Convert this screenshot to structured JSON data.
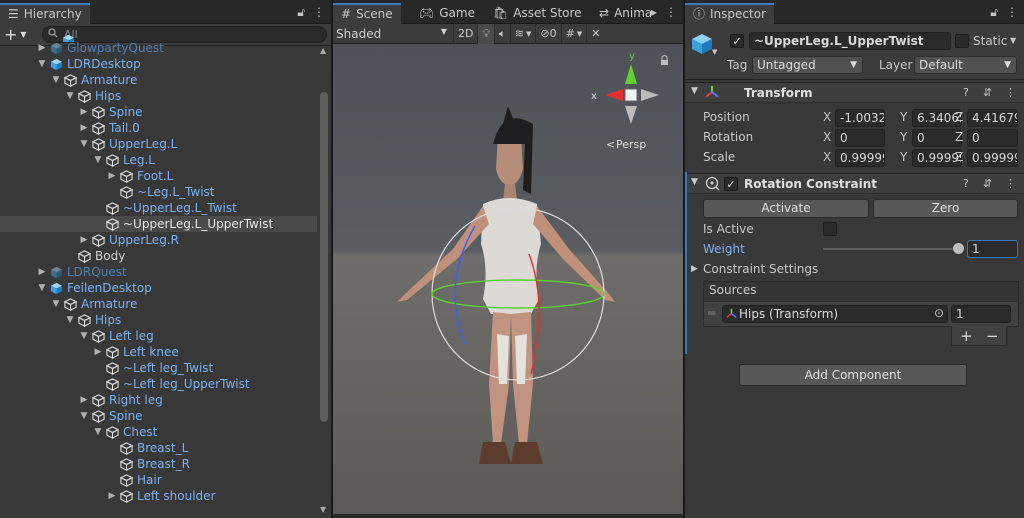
{
  "hierarchy": {
    "tab_label": "Hierarchy",
    "search_placeholder": "All",
    "items": [
      {
        "label": "GlowpartyQuest",
        "depth": 1,
        "arrow": "right",
        "kind": "prefab",
        "dim": true
      },
      {
        "label": "LDRDesktop",
        "depth": 1,
        "arrow": "down",
        "kind": "prefab"
      },
      {
        "label": "Armature",
        "depth": 2,
        "arrow": "down",
        "kind": "cube"
      },
      {
        "label": "Hips",
        "depth": 3,
        "arrow": "down",
        "kind": "cube"
      },
      {
        "label": "Spine",
        "depth": 4,
        "arrow": "right",
        "kind": "cube"
      },
      {
        "label": "Tail.0",
        "depth": 4,
        "arrow": "right",
        "kind": "cube"
      },
      {
        "label": "UpperLeg.L",
        "depth": 4,
        "arrow": "down",
        "kind": "cube"
      },
      {
        "label": "Leg.L",
        "depth": 5,
        "arrow": "down",
        "kind": "cube"
      },
      {
        "label": "Foot.L",
        "depth": 6,
        "arrow": "right",
        "kind": "cube"
      },
      {
        "label": "~Leg.L_Twist",
        "depth": 6,
        "arrow": "",
        "kind": "cube"
      },
      {
        "label": "~UpperLeg.L_Twist",
        "depth": 5,
        "arrow": "",
        "kind": "cube"
      },
      {
        "label": "~UpperLeg.L_UpperTwist",
        "depth": 5,
        "arrow": "",
        "kind": "cube",
        "selected": true
      },
      {
        "label": "UpperLeg.R",
        "depth": 4,
        "arrow": "right",
        "kind": "cube"
      },
      {
        "label": "Body",
        "depth": 3,
        "arrow": "",
        "kind": "cube"
      },
      {
        "label": "LDRQuest",
        "depth": 1,
        "arrow": "right",
        "kind": "prefab",
        "dim": true
      },
      {
        "label": "FeilenDesktop",
        "depth": 1,
        "arrow": "down",
        "kind": "prefab"
      },
      {
        "label": "Armature",
        "depth": 2,
        "arrow": "down",
        "kind": "cube"
      },
      {
        "label": "Hips",
        "depth": 3,
        "arrow": "down",
        "kind": "cube"
      },
      {
        "label": "Left leg",
        "depth": 4,
        "arrow": "down",
        "kind": "cube"
      },
      {
        "label": "Left knee",
        "depth": 5,
        "arrow": "right",
        "kind": "cube"
      },
      {
        "label": "~Left leg_Twist",
        "depth": 5,
        "arrow": "",
        "kind": "cube"
      },
      {
        "label": "~Left leg_UpperTwist",
        "depth": 5,
        "arrow": "",
        "kind": "cube"
      },
      {
        "label": "Right leg",
        "depth": 4,
        "arrow": "right",
        "kind": "cube"
      },
      {
        "label": "Spine",
        "depth": 4,
        "arrow": "down",
        "kind": "cube"
      },
      {
        "label": "Chest",
        "depth": 5,
        "arrow": "down",
        "kind": "cube"
      },
      {
        "label": "Breast_L",
        "depth": 6,
        "arrow": "",
        "kind": "cube"
      },
      {
        "label": "Breast_R",
        "depth": 6,
        "arrow": "",
        "kind": "cube"
      },
      {
        "label": "Hair",
        "depth": 6,
        "arrow": "",
        "kind": "cube"
      },
      {
        "label": "Left shoulder",
        "depth": 6,
        "arrow": "right",
        "kind": "cube"
      }
    ]
  },
  "scene": {
    "tabs": [
      "Scene",
      "Game",
      "Asset Store",
      "Anima"
    ],
    "shading_mode": "Shaded",
    "mode_2d": "2D",
    "hidden_count": "0",
    "persp_label": "Persp",
    "gizmo_x": "x",
    "gizmo_y": "y"
  },
  "inspector": {
    "tab_label": "Inspector",
    "object_name": "~UpperLeg.L_UpperTwist",
    "static_label": "Static",
    "tag_label": "Tag",
    "tag_value": "Untagged",
    "layer_label": "Layer",
    "layer_value": "Default",
    "transform": {
      "title": "Transform",
      "position_label": "Position",
      "rotation_label": "Rotation",
      "scale_label": "Scale",
      "position": [
        "-1.0032",
        "6.34065",
        "4.41679"
      ],
      "rotation": [
        "0",
        "0",
        "0"
      ],
      "scale": [
        "0.99999",
        "0.99999",
        "0.99999"
      ],
      "axis": [
        "X",
        "Y",
        "Z"
      ]
    },
    "rotation_constraint": {
      "title": "Rotation Constraint",
      "activate_label": "Activate",
      "zero_label": "Zero",
      "is_active_label": "Is Active",
      "weight_label": "Weight",
      "weight_value": "1",
      "weight_level": 1.0,
      "settings_label": "Constraint Settings",
      "sources_label": "Sources",
      "source_name": "Hips (Transform)",
      "source_weight": "1",
      "plus": "+",
      "minus": "−"
    },
    "add_component_label": "Add Component",
    "accent_color": "#3a79bb"
  }
}
